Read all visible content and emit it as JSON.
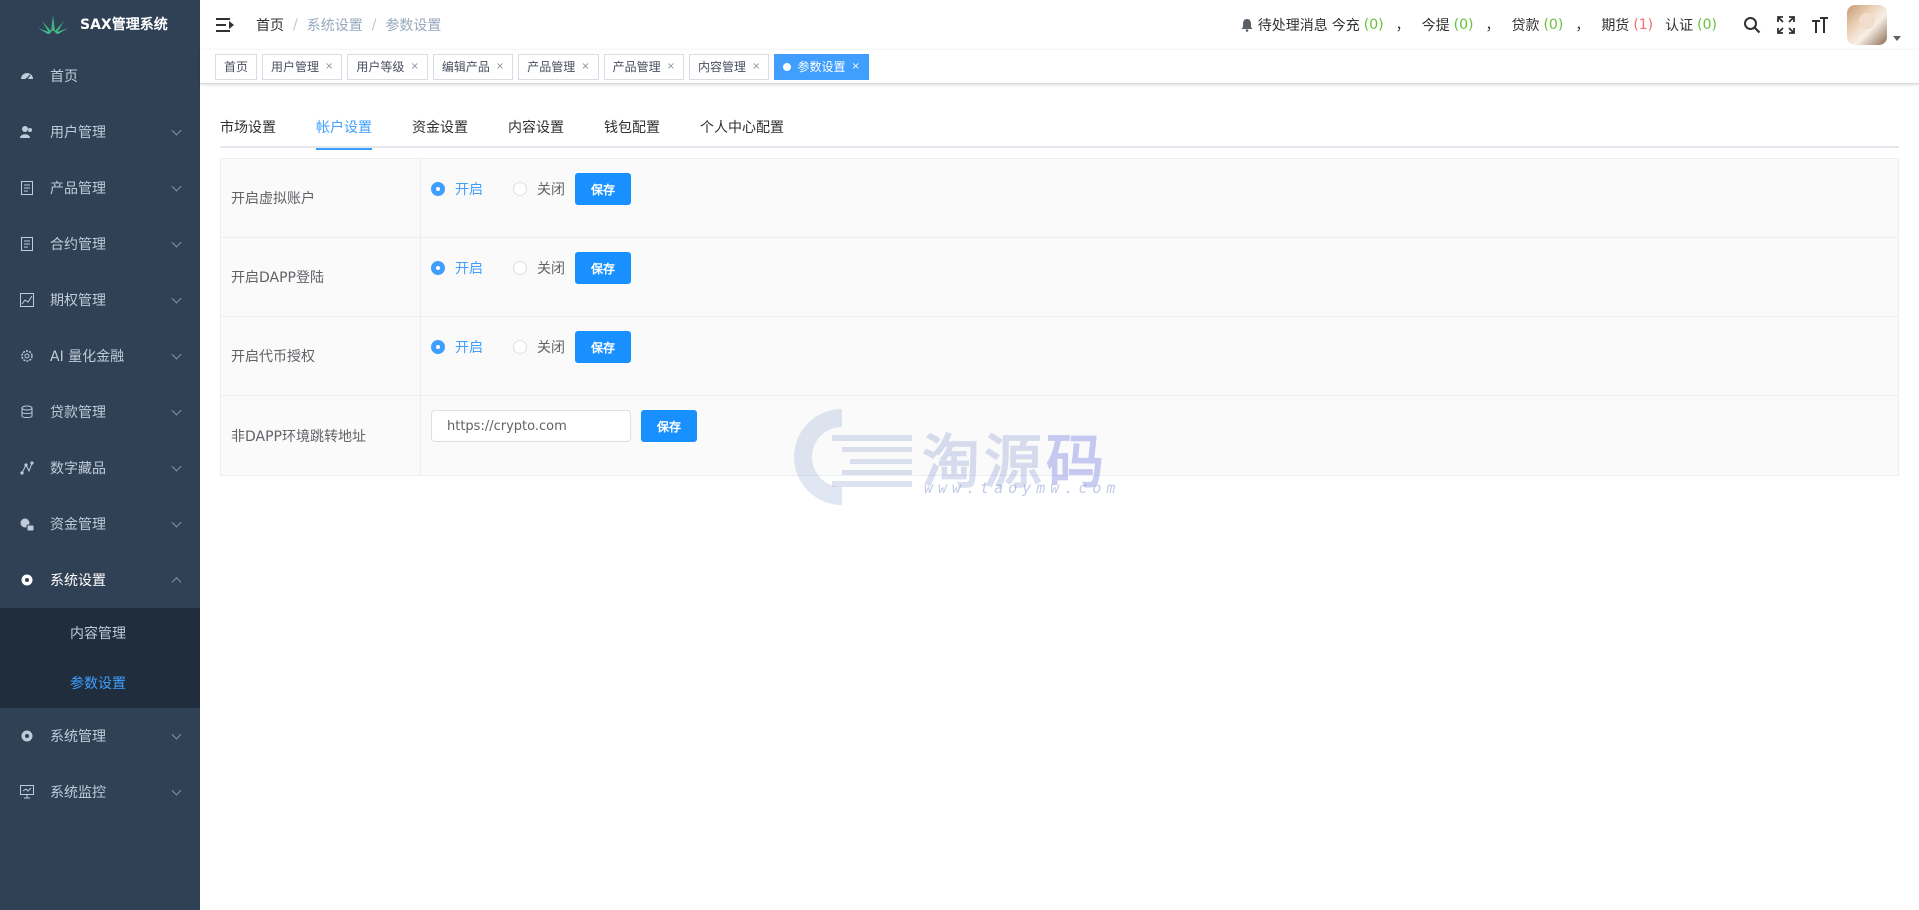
{
  "app": {
    "title": "SAX管理系统"
  },
  "sidebar": {
    "items": [
      {
        "label": "首页",
        "icon": "dashboard-icon"
      },
      {
        "label": "用户管理",
        "icon": "users-icon"
      },
      {
        "label": "产品管理",
        "icon": "document-icon"
      },
      {
        "label": "合约管理",
        "icon": "document-icon"
      },
      {
        "label": "期权管理",
        "icon": "chart-icon"
      },
      {
        "label": "AI 量化金融",
        "icon": "gear-icon"
      },
      {
        "label": "贷款管理",
        "icon": "coins-icon"
      },
      {
        "label": "数字藏品",
        "icon": "nodes-icon"
      },
      {
        "label": "资金管理",
        "icon": "money-icon"
      },
      {
        "label": "系统设置",
        "icon": "gear-icon"
      },
      {
        "label": "系统管理",
        "icon": "gear-icon"
      },
      {
        "label": "系统监控",
        "icon": "monitor-icon"
      }
    ],
    "submenu": [
      {
        "label": "内容管理"
      },
      {
        "label": "参数设置"
      }
    ]
  },
  "breadcrumb": [
    "首页",
    "系统设置",
    "参数设置"
  ],
  "header": {
    "notice_label": "待处理消息",
    "counters": [
      {
        "label": "今充",
        "value": "(0)"
      },
      {
        "label": "今提",
        "value": "(0)"
      },
      {
        "label": "贷款",
        "value": "(0)"
      },
      {
        "label": "期货",
        "value": "(1)"
      },
      {
        "label": "认证",
        "value": "(0)"
      }
    ],
    "comma": "，"
  },
  "tags": [
    {
      "label": "首页",
      "closable": false
    },
    {
      "label": "用户管理",
      "closable": true
    },
    {
      "label": "用户等级",
      "closable": true
    },
    {
      "label": "编辑产品",
      "closable": true
    },
    {
      "label": "产品管理",
      "closable": true
    },
    {
      "label": "产品管理",
      "closable": true
    },
    {
      "label": "内容管理",
      "closable": true
    },
    {
      "label": "参数设置",
      "closable": true,
      "active": true
    }
  ],
  "tag_close": "×",
  "tabs": [
    "市场设置",
    "帐户设置",
    "资金设置",
    "内容设置",
    "钱包配置",
    "个人中心配置"
  ],
  "form": {
    "rows": [
      {
        "label": "开启虚拟账户",
        "on": "开启",
        "off": "关闭",
        "save": "保存"
      },
      {
        "label": "开启DAPP登陆",
        "on": "开启",
        "off": "关闭",
        "save": "保存"
      },
      {
        "label": "开启代币授权",
        "on": "开启",
        "off": "关闭",
        "save": "保存"
      },
      {
        "label": "非DAPP环境跳转地址",
        "value": "https://crypto.com",
        "save": "保存"
      }
    ]
  },
  "watermark": {
    "text_main": "淘源",
    "text_accent": "码",
    "url": "www.taoymw.com"
  },
  "colors": {
    "sidebar_bg": "#304156",
    "submenu_bg": "#1f2d3d",
    "primary": "#409eff",
    "button": "#1890ff",
    "success": "#67c23a",
    "danger": "#f56c6c"
  }
}
